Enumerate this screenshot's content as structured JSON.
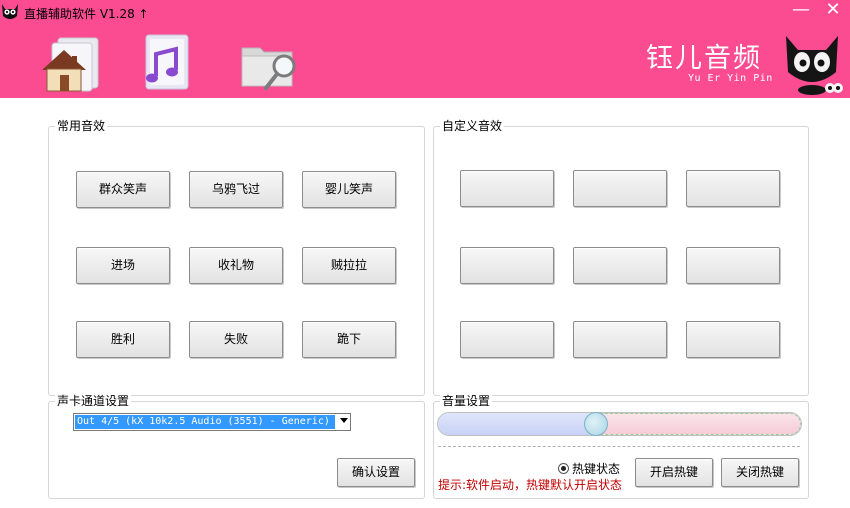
{
  "app": {
    "title": "直播辅助软件 V1.28 ↑",
    "brand": "钰儿音频",
    "brand_sub": "Yu Er Yin Pin",
    "accent_color": "#fb4c92"
  },
  "window_controls": {
    "minimize": "—",
    "close": "✕"
  },
  "toolbar": [
    {
      "icon": "home-icon"
    },
    {
      "icon": "music-file-icon"
    },
    {
      "icon": "folder-search-icon"
    }
  ],
  "common_effects": {
    "title": "常用音效",
    "buttons": [
      "群众笑声",
      "乌鸦飞过",
      "婴儿笑声",
      "进场",
      "收礼物",
      "贼拉拉",
      "胜利",
      "失败",
      "跪下"
    ]
  },
  "custom_effects": {
    "title": "自定义音效",
    "buttons": [
      "",
      "",
      "",
      "",
      "",
      "",
      "",
      "",
      ""
    ]
  },
  "soundcard": {
    "title": "声卡通道设置",
    "selected": "Out 4/5 (kX 10k2.5 Audio (3551) - Generic)",
    "confirm_label": "确认设置"
  },
  "volume": {
    "title": "音量设置",
    "level": 0.43,
    "hotkey_label": "热键状态",
    "hotkey_checked": true,
    "enable_hotkey_label": "开启热键",
    "disable_hotkey_label": "关闭热键",
    "hint": "提示:软件启动，热键默认开启状态"
  }
}
